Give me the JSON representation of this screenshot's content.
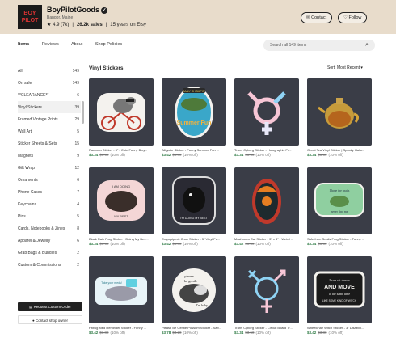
{
  "shop": {
    "logo_text": "BOY PILOT",
    "name": "BoyPilotGoods",
    "location": "Bangor, Maine",
    "rating": "4.9 (7k)",
    "sales": "26.2k sales",
    "years": "15 years on Etsy",
    "contact_label": "Contact",
    "follow_label": "Follow"
  },
  "tabs": [
    "Items",
    "Reviews",
    "About",
    "Shop Policies"
  ],
  "search": {
    "placeholder": "Search all 149 items"
  },
  "sidebar": {
    "items": [
      {
        "label": "All",
        "count": "149"
      },
      {
        "label": "On sale",
        "count": "149"
      },
      {
        "label": "**CLEARANCE**",
        "count": "6"
      },
      {
        "label": "Vinyl Stickers",
        "count": "39"
      },
      {
        "label": "Framed Vintage Prints",
        "count": "29"
      },
      {
        "label": "Wall Art",
        "count": "5"
      },
      {
        "label": "Sticker Sheets & Sets",
        "count": "15"
      },
      {
        "label": "Magnets",
        "count": "9"
      },
      {
        "label": "Gift Wrap",
        "count": "12"
      },
      {
        "label": "Ornaments",
        "count": "6"
      },
      {
        "label": "Phone Cases",
        "count": "7"
      },
      {
        "label": "Keychains",
        "count": "4"
      },
      {
        "label": "Pins",
        "count": "5"
      },
      {
        "label": "Cards, Notebooks & Zines",
        "count": "8"
      },
      {
        "label": "Apparel & Jewelry",
        "count": "6"
      },
      {
        "label": "Grab Bags & Bundles",
        "count": "2"
      },
      {
        "label": "Custom & Commissions",
        "count": "2"
      }
    ],
    "request_label": "Request Custom Order",
    "contact_owner_label": "Contact shop owner"
  },
  "section_title": "Vinyl Stickers",
  "sort_label": "Sort: Most Recent",
  "products": [
    {
      "title": "Raccoon Sticker - 3\" - Cute Funny Bicy...",
      "price": "$3.34",
      "was": "$3.50",
      "off": "(10% off)"
    },
    {
      "title": "Alligator Sticker - Funny Summer Fun ...",
      "price": "$3.42",
      "was": "$3.80",
      "off": "(10% off)"
    },
    {
      "title": "Trans Cyborg Sticker - Holographic Pr...",
      "price": "$3.34",
      "was": "$3.50",
      "off": "(10% off)"
    },
    {
      "title": "Ghost Tea Vinyl Sticker | Spooky Hallo...",
      "price": "$3.34",
      "was": "$3.50",
      "off": "(10% off)"
    },
    {
      "title": "Black Rain Frog Sticker - Doing My Bes...",
      "price": "$3.34",
      "was": "$3.50",
      "off": "(10% off)"
    },
    {
      "title": "Crapquipeck Crow Sticker - 3\" Vinyl Fu...",
      "price": "$3.42",
      "was": "$3.80",
      "off": "(10% off)"
    },
    {
      "title": "Mushroom Cat Sticker - 3\" x 3\" - Weird ...",
      "price": "$3.42",
      "was": "$3.80",
      "off": "(10% off)"
    },
    {
      "title": "Safe from Snails Frog Sticker - Funny ...",
      "price": "$3.34",
      "was": "$3.50",
      "off": "(10% off)"
    },
    {
      "title": "Pitbug Med Reminder Sticker - Funny ...",
      "price": "$3.42",
      "was": "$3.80",
      "off": "(10% off)"
    },
    {
      "title": "Please Be Gentle Possum Sticker - Sab...",
      "price": "$3.78",
      "was": "$4.20",
      "off": "(10% off)"
    },
    {
      "title": "Trans Cyborg Sticker - Circuit Board Tr...",
      "price": "$3.34",
      "was": "$3.50",
      "off": "(10% off)"
    },
    {
      "title": "Wheelchair Witch Sticker - 3\" Disabilit...",
      "price": "$3.42",
      "was": "$3.80",
      "off": "(10% off)"
    }
  ],
  "sticker_text": {
    "s2_top": "DAILY CHOMPIN'",
    "s2_bottom": "Summer Fun",
    "s5_top": "I AM DOING",
    "s5_bottom": "MY BEST",
    "s6": "I'M DOING MY BEST",
    "s8_top": "I hope the snails",
    "s8_bottom": "never find me",
    "s9": "Take your meds!",
    "s10_top": "please",
    "s10_mid": "be gentle",
    "s10_bot": "I'm baby",
    "s12_a": "I can sit down",
    "s12_b": "AND MOVE",
    "s12_c": "at the same time",
    "s12_d": "LIKE SOME KIND OF WITCH"
  },
  "colors": {
    "header_bg": "#e8dccb",
    "price_green": "#2d7a44",
    "thumb_bg": "#3a3d47"
  }
}
